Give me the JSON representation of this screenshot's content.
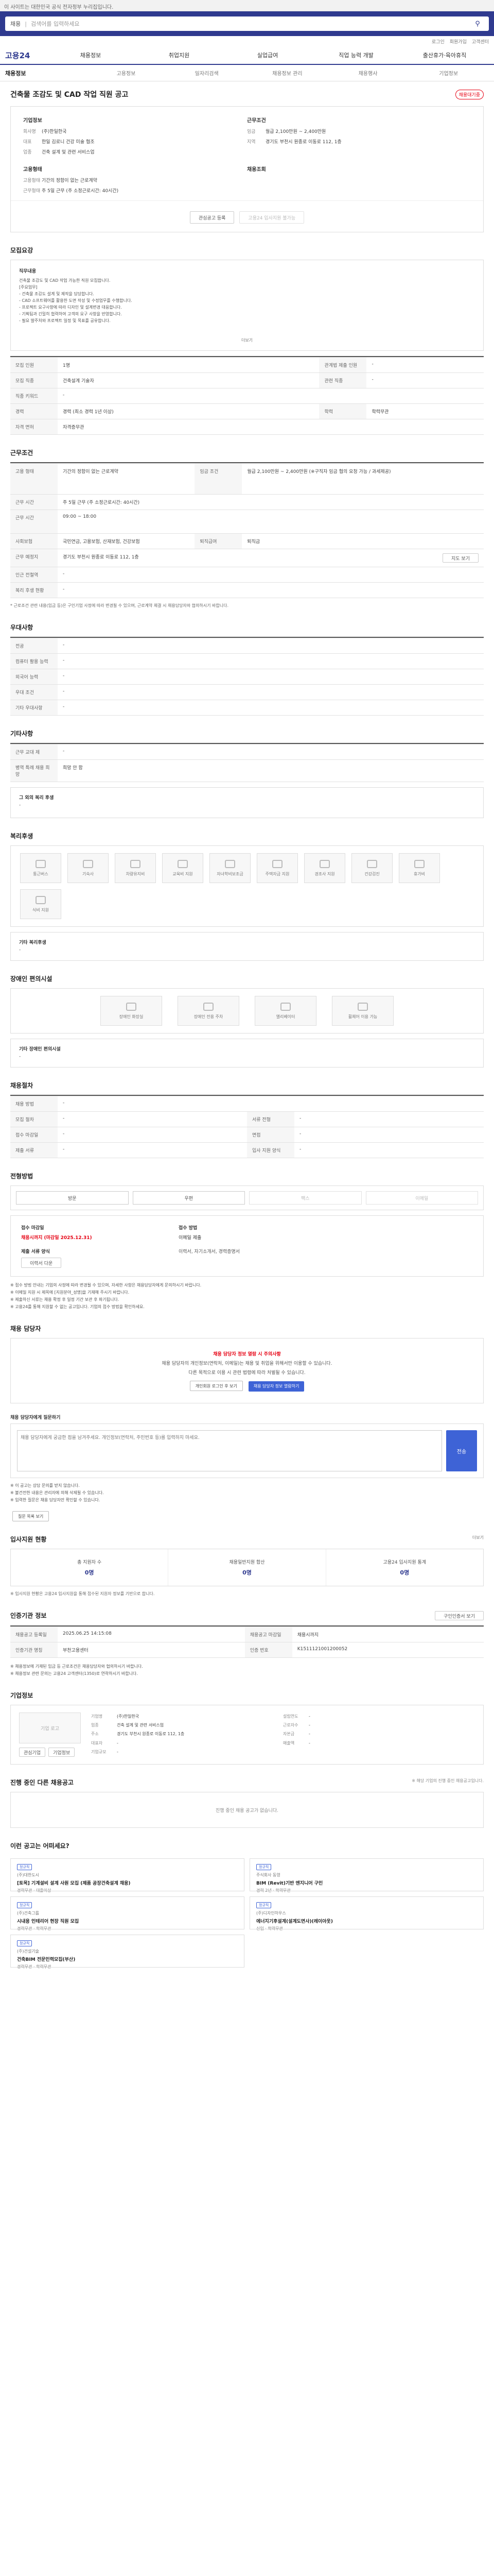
{
  "topbar": {
    "notice": "이 사이트는 대한민국 공식 전자정부 누리집입니다."
  },
  "search": {
    "category": "채용",
    "placeholder": "검색어를 입력하세요"
  },
  "util": [
    "로그인",
    "회원가입",
    "고객센터"
  ],
  "gnb": {
    "logo": "고용24",
    "items": [
      "채용정보",
      "취업지원",
      "실업급여",
      "직업 능력 개발",
      "출산휴가·육아휴직"
    ]
  },
  "lnb": [
    "채용정보",
    "고용정보",
    "일자리검색",
    "채용정보 관리",
    "채용행사",
    "기업정보"
  ],
  "job": {
    "title": "건축물 조감도 및 CAD 작업 직원 공고",
    "badge": "채용대기중",
    "company_head": "기업정보",
    "company_rows": [
      [
        "회사명",
        "(주)한일한국"
      ],
      [
        "대표",
        "한일 김로니 건강 미술 협조"
      ],
      [
        "업종",
        "건축 설계 및 관련 서비스업"
      ]
    ],
    "cond_head": "근무조건",
    "cond_rows": [
      [
        "임금",
        "월급 2,100만원 ~ 2,400만원"
      ],
      [
        "지역",
        "경기도 부천시 원종로 이동로 112, 1층"
      ]
    ],
    "employ_head": "고용형태",
    "employ_rows": [
      [
        "고용형태",
        "기간의 정함이 없는 근로계약"
      ],
      [
        "근무형태",
        "주 5일 근무 (주 소정근로시간: 40시간)"
      ]
    ],
    "extra_head": "채용조회",
    "buttons": {
      "scrap": "관심공고 등록",
      "apply": "고용24 입사지원 불가능"
    }
  },
  "recruit": {
    "title": "모집요강",
    "desc_label": "직무내용",
    "desc_lines": [
      "건축물 조감도 및 CAD 작업 가능한 직원 모집합니다.",
      "",
      "[주요업무]",
      "- 건축물 조감도 설계 및 제작을 담당합니다.",
      "- CAD 소프트웨어를 활용한 도면 작성 및 수정업무를 수행합니다.",
      "- 프로젝트 요구사항에 따라 디자인 및 설계변경 대응합니다.",
      "- 기획팀과 긴밀히 협력하여 고객의 요구 사항을 반영합니다.",
      "- 필요 발주처와 프로젝트 일정 및 목표를 공유합니다."
    ],
    "more": "더보기",
    "rows": [
      [
        "모집 인원",
        "1명",
        "관계법 제출 인원",
        "-"
      ],
      [
        "모집 직종",
        "건축설계 기술자",
        "관련 직종",
        "-"
      ],
      [
        "직종 키워드",
        "-",
        "",
        ""
      ],
      [
        "경력",
        "경력 (최소 경력 1년 이상)",
        "학력",
        "학력무관"
      ],
      [
        "자격 면허",
        "자격증무관",
        "",
        ""
      ]
    ]
  },
  "work": {
    "title": "근무조건",
    "rows": [
      [
        "고용 형태",
        "기간의 정함이 없는 근로계약",
        "임금 조건",
        "월급 2,100만원 ~ 2,400만원 (※구직자 임금 협의 요청 가능 / 과세제공)"
      ],
      [
        "근무 시간",
        "주 5일 근무 (주 소정근로시간: 40시간)",
        "",
        ""
      ],
      [
        "근무 시간",
        "09:00 ~ 18:00",
        "",
        ""
      ],
      [
        "사회보험",
        "국민연금, 고용보험, 산재보험, 건강보험",
        "퇴직급여",
        "퇴직금"
      ],
      [
        "근무 예정지",
        "경기도 부천시 원종로 이동로 112, 1층",
        "",
        ""
      ],
      [
        "인근 전철역",
        "-",
        "",
        ""
      ],
      [
        "복리 후생 현황",
        "-",
        "",
        ""
      ]
    ],
    "map_btn": "지도 보기",
    "note": "* 근로조건 관련 내용(임금 등)은 구인기업 사정에 따라 변경될 수 있으며, 근로계약 체결 시 채용담당자와 협의하시기 바랍니다."
  },
  "welfare": {
    "title": "우대사항",
    "rows": [
      [
        "전공",
        "-"
      ],
      [
        "컴퓨터 활용 능력",
        "-"
      ],
      [
        "외국어 능력",
        "-"
      ],
      [
        "우대 조건",
        "-"
      ],
      [
        "기타 우대사항",
        "-"
      ]
    ]
  },
  "other": {
    "title": "기타사항",
    "rows": [
      [
        "근무 교대 제",
        "-"
      ],
      [
        "병역 특례 채용 희망",
        "희망 안 함"
      ]
    ],
    "etc_label": "그 외의 복리 후생",
    "etc_value": "-"
  },
  "benefits": {
    "title": "복리후생",
    "icons": [
      "통근버스",
      "기숙사",
      "차량유지비",
      "교육비 지원",
      "자녀학비보조금",
      "주택자금 지원",
      "경조사 지원",
      "건강검진",
      "휴가비",
      "식비 지원"
    ],
    "etc_label": "기타 복리후생",
    "etc_value": "-"
  },
  "disability": {
    "title": "장애인 편의시설",
    "icons": [
      "장애인 화장실",
      "장애인 전용 주차",
      "엘리베이터",
      "휠체어 이용 가능"
    ],
    "etc_label": "기타 장애인 편의시설",
    "etc_value": "-"
  },
  "process": {
    "title": "채용절차",
    "rows": [
      [
        "채용 방법",
        "-",
        "",
        ""
      ],
      [
        "모집 절차",
        "-",
        "서류 전형",
        "-"
      ],
      [
        "접수 마감일",
        "-",
        "면접",
        "-"
      ],
      [
        "제출 서류",
        "-",
        "입사 지원 양식",
        "-"
      ]
    ]
  },
  "apply": {
    "title": "전형방법",
    "buttons": [
      "방문",
      "우편",
      "팩스",
      "이메일"
    ],
    "deadline_label": "접수 마감일",
    "deadline_value": "채용시까지 (마감일 2025.12.31)",
    "method_label": "접수 방법",
    "method_value": "이메일 제출",
    "docs_label": "제출 서류 양식",
    "docs_value": "이력서, 자기소개서, 경력증명서",
    "docs_btn": "이력서 다운",
    "bullets": [
      "※ 접수 방법 안내는 기업의 사정에 따라 변경될 수 있으며, 자세한 사항은 채용담당자에게 문의하시기 바랍니다.",
      "※ 이메일 지원 시 제목에 [지원분야_성명]을 기재해 주시기 바랍니다.",
      "※ 제출하신 서류는 채용 확정 후 일정 기간 보관 후 파기됩니다.",
      "※ 고용24를 통해 지원할 수 없는 공고입니다. 기업의 접수 방법을 확인하세요."
    ]
  },
  "manager": {
    "title": "채용 담당자",
    "warning": "채용 담당자 정보 열람 시 주의사항",
    "text1": "채용 담당자의 개인정보(연락처, 이메일)는 채용 및 취업을 위해서만 이용할 수 있습니다.",
    "text2": "다른 목적으로 이용 시 관련 법령에 따라 처벌될 수 있습니다.",
    "btn_login": "개인회원 로그인 후 보기",
    "btn_view": "채용 담당자 정보 열람하기"
  },
  "qna": {
    "title": "채용 담당자에게 질문하기",
    "placeholder": "채용 담당자에게 궁금한 점을 남겨주세요. 개인정보(연락처, 주민번호 등)를 입력하지 마세요.",
    "send": "전송",
    "notes": [
      "※ 이 공고는 상담 문의를 받지 않습니다.",
      "※ 불건전한 내용은 관리자에 의해 삭제될 수 있습니다.",
      "※ 입력한 질문은 채용 담당자만 확인할 수 있습니다."
    ],
    "list_btn": "질문 목록 보기"
  },
  "stats": {
    "title": "입사지원 현황",
    "more": "더보기",
    "items": [
      [
        "총 지원자 수",
        "0명"
      ],
      [
        "채용일반지원 합산",
        "0명"
      ],
      [
        "고용24 입사지원 통계",
        "0명"
      ]
    ],
    "note": "※ 입사지원 현황은 고용24 입사지원을 통해 접수된 지원자 정보를 기반으로 합니다."
  },
  "info": {
    "title": "인증기관 정보",
    "btn": "구인인증서 보기",
    "rows": [
      [
        "채용공고 등록일",
        "2025.06.25 14:15:08",
        "채용공고 마감일",
        "채용시까지"
      ],
      [
        "인증기관 명칭",
        "부천고용센터",
        "인증 번호",
        "K1511121001200052"
      ]
    ],
    "notes": [
      "※ 채용정보에 기재된 임금 등 근로조건은 채용담당자와 협의하시기 바랍니다.",
      "※ 채용정보 관련 문의는 고용24 고객센터(1350)로 연락하시기 바랍니다."
    ]
  },
  "companyinfo": {
    "title": "기업정보",
    "logo": "기업 로고",
    "btn1": "관심기업",
    "btn2": "기업정보",
    "rows": [
      [
        "기업명",
        "(주)한일한국",
        "설립연도",
        "-"
      ],
      [
        "업종",
        "건축 설계 및 관련 서비스업",
        "근로자수",
        "-"
      ],
      [
        "주소",
        "경기도 부천시 원종로 이동로 112, 1층",
        "자본금",
        "-"
      ],
      [
        "대표자",
        "-",
        "매출액",
        "-"
      ],
      [
        "기업규모",
        "-",
        "",
        ""
      ]
    ]
  },
  "related": {
    "title": "진행 중인 다른 채용공고",
    "empty": "진행 중인 채용 공고가 없습니다.",
    "legend": "※ 해당 기업의 진행 중인 채용공고입니다."
  },
  "recommend": {
    "title": "이런 공고는 어떠세요?",
    "cards": [
      {
        "tag": "정규직",
        "co": "(주)대한도시",
        "title": "[토목] 기계설비 설계 사원 모집 (제품 공장건축설계 채용)",
        "meta": "경력무관 · 대졸이상"
      },
      {
        "tag": "정규직",
        "co": "주식회사 동영",
        "title": "BIM (Revit)기반 엔지니어 구인",
        "meta": "경력 2년 · 학력무관"
      },
      {
        "tag": "정규직",
        "co": "(주)건축그룹",
        "title": "시내용 인테리어 현장 직원 모집",
        "meta": "경력무관 · 학력무관"
      },
      {
        "tag": "정규직",
        "co": "(주)디자인하우스",
        "title": "에너지기후설계(설계도면사)(레이아웃)",
        "meta": "신입 · 학력무관"
      },
      {
        "tag": "정규직",
        "co": "(주)건설기술",
        "title": "건축BIM 전문인력모집(부산)",
        "meta": "경력무관 · 학력무관"
      }
    ]
  }
}
